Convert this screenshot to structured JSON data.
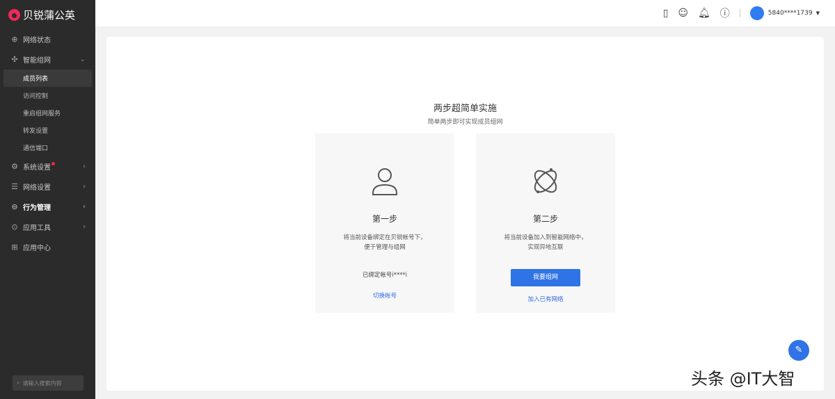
{
  "brand": "贝锐蒲公英",
  "sidebar": {
    "items": [
      {
        "label": "网络状态"
      },
      {
        "label": "智能组网"
      },
      {
        "label": "系统设置"
      },
      {
        "label": "网络设置"
      },
      {
        "label": "行为管理"
      },
      {
        "label": "应用工具"
      },
      {
        "label": "应用中心"
      }
    ],
    "sub": [
      "成员列表",
      "访问控制",
      "重启组网服务",
      "转发设置",
      "通信端口"
    ],
    "search_placeholder": "请输入搜索内容"
  },
  "topbar": {
    "user": "5840****1739"
  },
  "main": {
    "title": "两步超简单实施",
    "subtitle": "简单两步即可实现成员组网",
    "step1": {
      "title": "第一步",
      "desc1": "将当前设备绑定在贝锐帐号下，",
      "desc2": "便于管理与组网",
      "bound": "已绑定帐号i****i",
      "link": "切换帐号"
    },
    "step2": {
      "title": "第二步",
      "desc1": "将当前设备加入到智能网络中，",
      "desc2": "实现异地互联",
      "button": "我要组网",
      "link": "加入已有网络"
    }
  },
  "watermark": "头条 @IT大智"
}
